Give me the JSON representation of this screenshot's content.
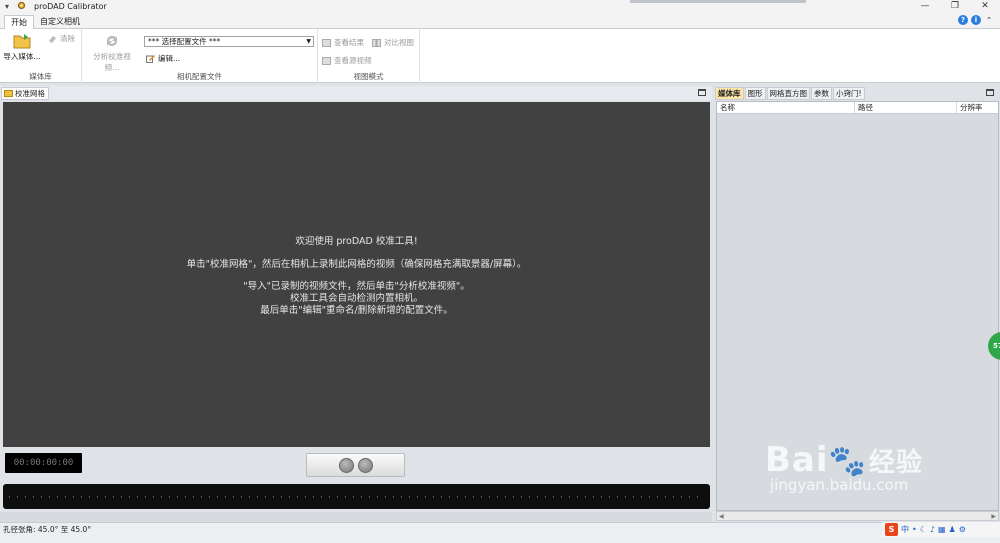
{
  "titlebar": {
    "title": "proDAD Calibrator",
    "menu_glyph": "▾",
    "app_icon": "gear-icon"
  },
  "window_controls": {
    "minimize": "—",
    "restore": "❐",
    "close": "✕"
  },
  "ribbon_tabs": [
    "开始",
    "自定义相机"
  ],
  "help": {
    "question": "?",
    "info": "i",
    "caret": "⌃"
  },
  "ribbon": {
    "media_group": {
      "import_label": "导入媒体...",
      "clear_label": "清除",
      "group_label": "媒体库"
    },
    "camera_group": {
      "analyze_label": "分析校准视频...",
      "profile_select": "*** 选择配置文件 ***",
      "edit_label": "编辑...",
      "group_label": "相机配置文件"
    },
    "view_group": {
      "view_result": "查看结果",
      "compare_view": "对比视图",
      "view_source": "查看源视频",
      "group_label": "视图模式"
    }
  },
  "left_panel": {
    "tab_label": "校准网格"
  },
  "canvas": {
    "line1": "欢迎使用 proDAD 校准工具!",
    "line2": "单击\"校准网格\"，然后在相机上录制此网格的视频（确保网格充满取景器/屏幕）。",
    "line3": "\"导入\"已录制的视频文件，然后单击\"分析校准视频\"。",
    "line4": "校准工具会自动检测内置相机。",
    "line5": "最后单击\"编辑\"重命名/删除新增的配置文件。"
  },
  "transport": {
    "timecode": "00:00:00:00"
  },
  "right_panel": {
    "tabs": [
      "媒体库",
      "图形",
      "网格直方图",
      "参数",
      "小窍门!"
    ],
    "columns": {
      "name": "名称",
      "path": "路径",
      "resolution": "分辨率"
    },
    "side_badge": "57"
  },
  "statusbar": {
    "text": "孔径张角: 45.0° 至 45.0°"
  },
  "ime": {
    "logo": "S",
    "chinese": "中"
  },
  "watermark": {
    "brand": "Bai",
    "brand_cn": "经验",
    "url": "jingyan.baidu.com"
  },
  "colors": {
    "canvas_bg": "#414141",
    "accent_tab": "#fde6a8",
    "help_blue": "#2b7de0",
    "badge_green": "#2ea84a"
  }
}
